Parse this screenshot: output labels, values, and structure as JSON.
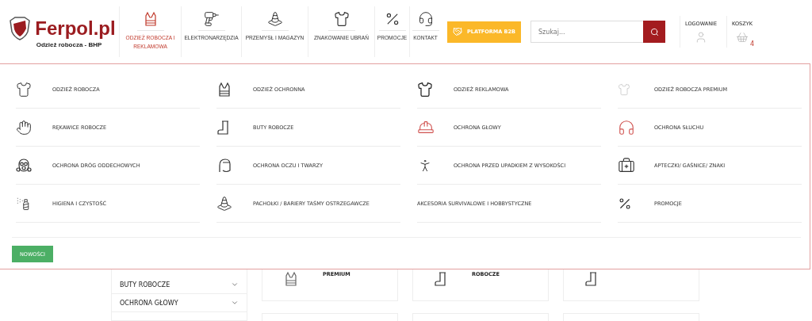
{
  "logo": {
    "name": "Ferpol.pl",
    "tagline": "Odzież robocza - BHP"
  },
  "nav": [
    {
      "label": "ODZIEŻ ROBOCZA I REKLAMOWA",
      "selected": true
    },
    {
      "label": "ELEKTRONARZĘDZIA",
      "selected": false
    },
    {
      "label": "PRZEMYSŁ I MAGAZYN",
      "selected": false
    },
    {
      "label": "ZNAKOWANIE UBRAŃ",
      "selected": false
    },
    {
      "label": "PROMOCJE",
      "selected": false
    },
    {
      "label": "KONTAKT",
      "selected": false
    }
  ],
  "b2b_button": "PLATFORMA B2B",
  "search": {
    "placeholder": "Szukaj..."
  },
  "account": {
    "login": "LOGOWANIE",
    "cart": "KOSZYK",
    "cart_count": "4"
  },
  "menu": {
    "items": [
      {
        "label": "ODZIEŻ ROBOCZA"
      },
      {
        "label": "ODZIEŻ OCHRONNA"
      },
      {
        "label": "ODZIEŻ REKLAMOWA"
      },
      {
        "label": "ODZIEŻ ROBOCZA PREMIUM"
      },
      {
        "label": "RĘKAWICE ROBOCZE"
      },
      {
        "label": "BUTY ROBOCZE"
      },
      {
        "label": "OCHRONA GŁOWY"
      },
      {
        "label": "OCHRONA SŁUCHU"
      },
      {
        "label": "OCHRONA DRÓG ODDECHOWYCH"
      },
      {
        "label": "OCHRONA OCZU I TWARZY"
      },
      {
        "label": "OCHRONA PRZED UPADKIEM Z WYSOKOŚCI"
      },
      {
        "label": "APTECZKI/ GAŚNICE/ ZNAKI"
      },
      {
        "label": "HIGIENA I CZYSTOŚĆ"
      },
      {
        "label": "PACHOŁKI / BARIERY TAŚMY OSTRZEGAWCZE"
      },
      {
        "label": "AKCESORIA SURVIVALOWE I HOBBYSTYCZNE"
      },
      {
        "label": "PROMOCJE"
      }
    ],
    "new_button": "NOWOŚCI"
  },
  "sidebar": {
    "items": [
      {
        "label": "BUTY ROBOCZE"
      },
      {
        "label": "OCHRONA GŁOWY"
      }
    ]
  },
  "cards": [
    {
      "title": "PREMIUM"
    },
    {
      "title": "ROBOCZE"
    }
  ]
}
